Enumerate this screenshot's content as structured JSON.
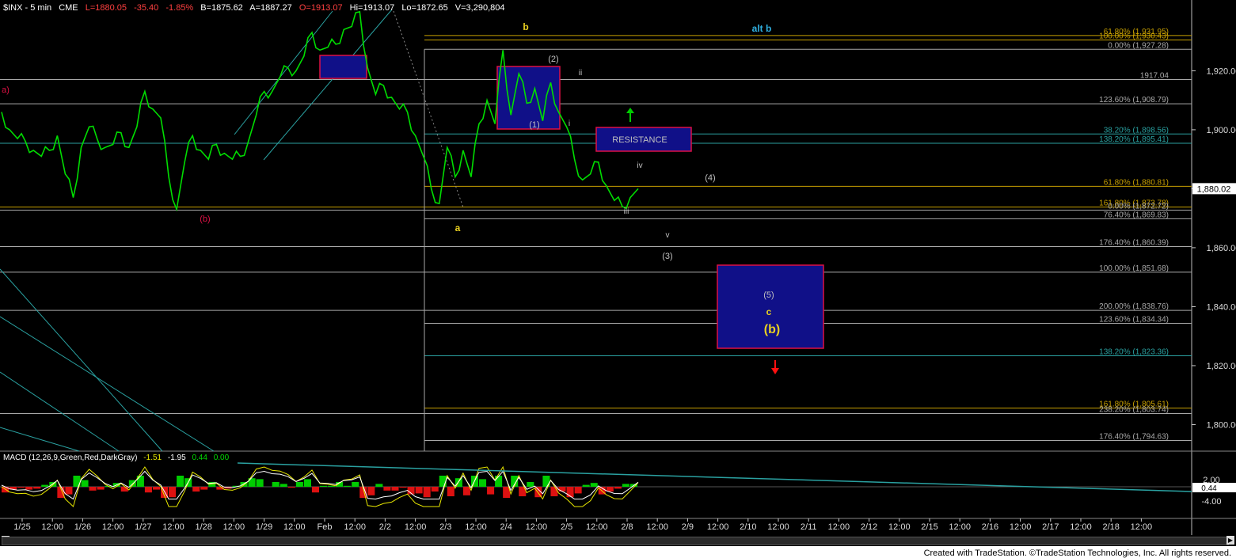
{
  "header": {
    "symbol": "$INX - 5 min",
    "exchange": "CME",
    "last": "L=1880.05",
    "change": "-35.40",
    "pct": "-1.85%",
    "bid": "B=1875.62",
    "ask": "A=1887.27",
    "open": "O=1913.07",
    "high": "Hi=1913.07",
    "low": "Lo=1872.65",
    "volume": "V=3,290,804"
  },
  "macd": {
    "label": "MACD (12,26,9,Green,Red,DarkGray)",
    "v1": "-1.51",
    "v2": "-1.95",
    "v3": "0.44",
    "v4": "0.00",
    "right_label": "0.44",
    "ticks": [
      "2.00",
      "-4.00"
    ]
  },
  "footer": {
    "text": "Created with TradeStation. ©TradeStation Technologies, Inc. All rights reserved."
  },
  "colors": {
    "background": "#000000",
    "price": "#00dd00",
    "fib_gold": "#c8a000",
    "fib_gray": "#a8a8a8",
    "fib_teal": "#2aa1a1",
    "box_fill": "#101088",
    "box_edge": "#dd1144",
    "label_yellow": "#e8d020",
    "label_gray": "#c0c0c0",
    "label_cyan": "#30b0e0",
    "arrow_green": "#00cc00",
    "arrow_red": "#ff1010"
  },
  "chart_data": {
    "type": "line",
    "title": "$INX - 5 min",
    "ylim": [
      1791,
      1944
    ],
    "y_ticks": [
      "1,920.00",
      "1,900.00",
      "1,880.00",
      "1,860.00",
      "1,840.00",
      "1,820.00",
      "1,800.00"
    ],
    "last_price_label": "1,880.02",
    "x_tick_labels": [
      "1/25",
      "12:00",
      "1/26",
      "12:00",
      "1/27",
      "12:00",
      "1/28",
      "12:00",
      "1/29",
      "12:00",
      "Feb",
      "12:00",
      "2/2",
      "12:00",
      "2/3",
      "12:00",
      "2/4",
      "12:00",
      "2/5",
      "12:00",
      "2/8",
      "12:00",
      "2/9",
      "12:00",
      "2/10",
      "12:00",
      "2/11",
      "12:00",
      "2/12",
      "12:00",
      "2/15",
      "12:00",
      "2/16",
      "12:00",
      "2/17",
      "12:00",
      "2/18",
      "12:00"
    ],
    "series": [
      {
        "values": [
          1906,
          1900,
          1897,
          1896,
          1893,
          1891,
          1893,
          1898,
          1885,
          1877,
          1894,
          1901,
          1897,
          1894,
          1895,
          1899,
          1894,
          1901,
          1913,
          1907,
          1904,
          1884,
          1873,
          1889,
          1898,
          1893,
          1890,
          1895,
          1892,
          1890,
          1891,
          1896,
          1905,
          1913,
          1913,
          1918,
          1921,
          1920,
          1925,
          1933,
          1927,
          1928,
          1929,
          1934,
          1935,
          1940,
          1921,
          1912,
          1915,
          1911,
          1907,
          1906,
          1898,
          1891,
          1880,
          1875,
          1894,
          1884,
          1893,
          1884,
          1902,
          1910,
          1902,
          1927,
          1905,
          1919,
          1909,
          1914,
          1903,
          1916,
          1906,
          1901,
          1890,
          1883,
          1885,
          1889,
          1881,
          1876,
          1874,
          1877,
          1880
        ]
      }
    ],
    "fib_levels": [
      {
        "label": "61.80% (1,931.95)",
        "value": 1931.95,
        "color": "#c8a000"
      },
      {
        "label": "100.00% (1,930.43)",
        "value": 1930.43,
        "color": "#c8a000"
      },
      {
        "label": "0.00% (1,927.28)",
        "value": 1927.28,
        "color": "#a8a8a8"
      },
      {
        "label": "1917.04",
        "value": 1917.04,
        "color": "#a8a8a8"
      },
      {
        "label": "123.60% (1,908.79)",
        "value": 1908.79,
        "color": "#a8a8a8"
      },
      {
        "label": "38.20% (1,898.56)",
        "value": 1898.56,
        "color": "#2aa1a1"
      },
      {
        "label": "138.20% (1,895.41)",
        "value": 1895.41,
        "color": "#2aa1a1"
      },
      {
        "label": "61.80% (1,880.81)",
        "value": 1880.81,
        "color": "#c8a000"
      },
      {
        "label": "161.80% (1,873.78)",
        "value": 1873.78,
        "color": "#c8a000"
      },
      {
        "label": "0.00% (1,872.72)",
        "value": 1872.72,
        "color": "#a8a8a8"
      },
      {
        "label": "76.40% (1,869.83)",
        "value": 1869.83,
        "color": "#a8a8a8"
      },
      {
        "label": "176.40% (1,860.39)",
        "value": 1860.39,
        "color": "#a8a8a8"
      },
      {
        "label": "100.00% (1,851.68)",
        "value": 1851.68,
        "color": "#a8a8a8"
      },
      {
        "label": "200.00% (1,838.76)",
        "value": 1838.76,
        "color": "#a8a8a8"
      },
      {
        "label": "123.60% (1,834.34)",
        "value": 1834.34,
        "color": "#a8a8a8"
      },
      {
        "label": "138.20% (1,823.36)",
        "value": 1823.36,
        "color": "#2aa1a1"
      },
      {
        "label": "161.80% (1,805.61)",
        "value": 1805.61,
        "color": "#c8a000"
      },
      {
        "label": "238.20% (1,803.74)",
        "value": 1803.74,
        "color": "#a8a8a8"
      },
      {
        "label": "176.40% (1,794.63)",
        "value": 1794.63,
        "color": "#a8a8a8"
      }
    ],
    "annotations": [
      {
        "text": "b",
        "color": "#e8d020"
      },
      {
        "text": "alt b",
        "color": "#30b0e0"
      },
      {
        "text": "a",
        "color": "#e8d020"
      },
      {
        "text": "(2)",
        "color": "#c0c0c0"
      },
      {
        "text": "ii",
        "color": "#c0c0c0"
      },
      {
        "text": "(1)",
        "color": "#c0c0c0"
      },
      {
        "text": "i",
        "color": "#c0c0c0"
      },
      {
        "text": "iv",
        "color": "#c0c0c0"
      },
      {
        "text": "(4)",
        "color": "#c0c0c0"
      },
      {
        "text": "iii",
        "color": "#c0c0c0"
      },
      {
        "text": "v",
        "color": "#c0c0c0"
      },
      {
        "text": "(3)",
        "color": "#c0c0c0"
      },
      {
        "text": "(5)",
        "color": "#c0c0c0"
      },
      {
        "text": "c",
        "color": "#e8d020"
      },
      {
        "text": "(b)",
        "color": "#e8d020"
      },
      {
        "text": "(b)",
        "color": "#dd1144"
      },
      {
        "text": "a)",
        "color": "#dd1144"
      },
      {
        "text": "RESISTANCE",
        "color": "#c0c0c0"
      }
    ]
  }
}
